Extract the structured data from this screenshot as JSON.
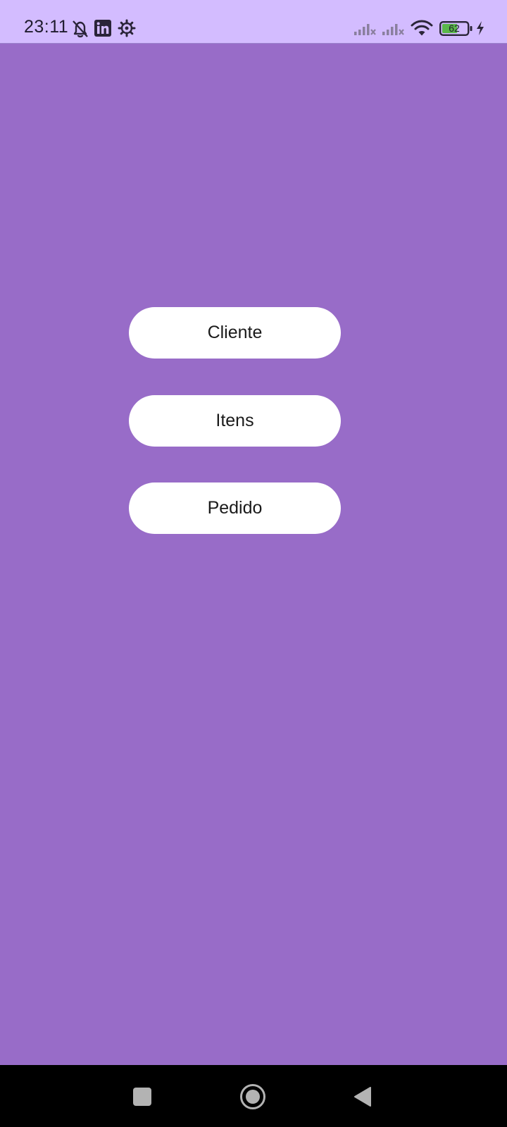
{
  "status_bar": {
    "time": "23:11",
    "battery_level": "62",
    "battery_level_fraction": 0.62,
    "background_color": "#d3bcff",
    "left_icons": [
      "bell-off-icon",
      "linkedin-icon",
      "settings-gear-icon"
    ],
    "right_icons": [
      "signal-no-service-icon",
      "signal-no-service-icon",
      "wifi-icon",
      "battery-icon",
      "charging-bolt-icon"
    ]
  },
  "main": {
    "background_color": "#986cc8",
    "buttons": [
      {
        "label": "Cliente"
      },
      {
        "label": "Itens"
      },
      {
        "label": "Pedido"
      }
    ]
  },
  "nav_bar": {
    "icons": [
      "recents-square-icon",
      "home-circle-icon",
      "back-triangle-icon"
    ]
  }
}
